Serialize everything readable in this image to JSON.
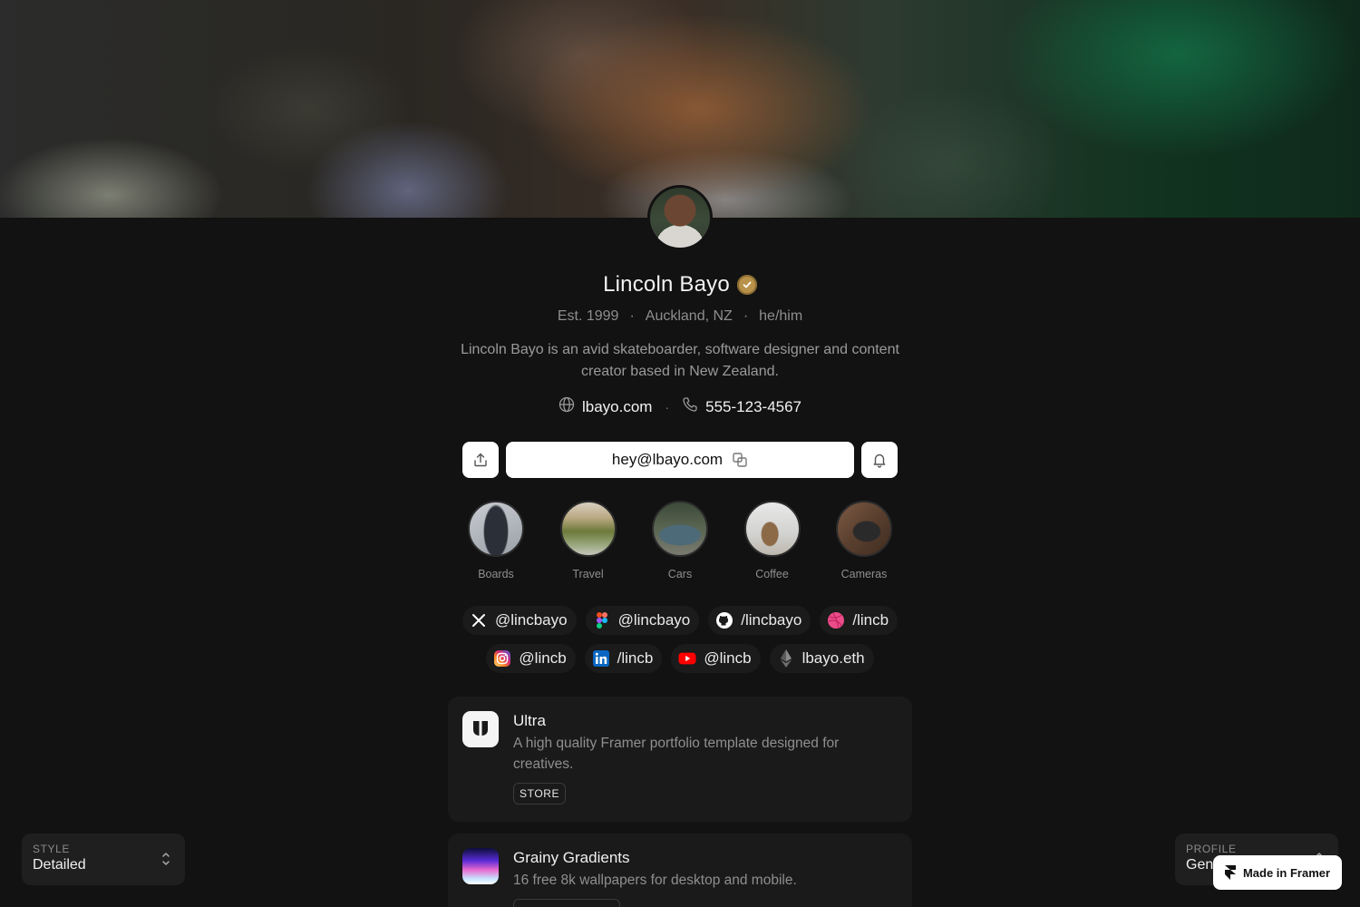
{
  "profile": {
    "name": "Lincoln Bayo",
    "meta": [
      "Est. 1999",
      "Auckland, NZ",
      "he/him"
    ],
    "meta_separator": "·",
    "bio": "Lincoln Bayo is an avid skateboarder, software designer and content creator based in New Zealand.",
    "website": "lbayo.com",
    "phone": "555-123-4567",
    "email": "hey@lbayo.com",
    "verified_color": "#b8924a"
  },
  "highlights": [
    {
      "label": "Boards"
    },
    {
      "label": "Travel"
    },
    {
      "label": "Cars"
    },
    {
      "label": "Coffee"
    },
    {
      "label": "Cameras"
    }
  ],
  "socials": {
    "row1": [
      {
        "icon": "x-icon",
        "handle": "@lincbayo"
      },
      {
        "icon": "figma-icon",
        "handle": "@lincbayo"
      },
      {
        "icon": "github-icon",
        "handle": "/lincbayo"
      },
      {
        "icon": "dribbble-icon",
        "handle": "/lincb"
      }
    ],
    "row2": [
      {
        "icon": "instagram-icon",
        "handle": "@lincb"
      },
      {
        "icon": "linkedin-icon",
        "handle": "/lincb"
      },
      {
        "icon": "youtube-icon",
        "handle": "@lincb"
      },
      {
        "icon": "ethereum-icon",
        "handle": "lbayo.eth"
      }
    ]
  },
  "cards": [
    {
      "title": "Ultra",
      "description": "A high quality Framer portfolio template designed for creatives.",
      "tag": "STORE"
    },
    {
      "title": "Grainy Gradients",
      "description": "16 free 8k wallpapers for desktop and mobile."
    }
  ],
  "controls": {
    "style_label": "STYLE",
    "style_value": "Detailed",
    "profile_label": "PROFILE",
    "profile_value": "Gen"
  },
  "badge": {
    "label": "Made in Framer"
  }
}
